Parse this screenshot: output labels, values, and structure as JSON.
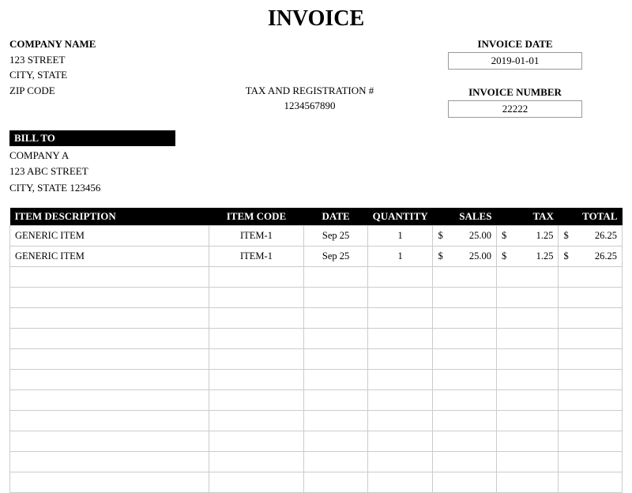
{
  "title": "INVOICE",
  "company": {
    "name": "COMPANY NAME",
    "street": "123 STREET",
    "city_state": "CITY, STATE",
    "zip": "ZIP CODE"
  },
  "tax_reg": {
    "label": "TAX AND REGISTRATION #",
    "value": "1234567890"
  },
  "invoice_date": {
    "label": "INVOICE DATE",
    "value": "2019-01-01"
  },
  "invoice_number": {
    "label": "INVOICE NUMBER",
    "value": "22222"
  },
  "bill_to": {
    "header": "BILL TO",
    "name": "COMPANY A",
    "street": "123 ABC STREET",
    "city_state_zip": "CITY, STATE 123456"
  },
  "items_header": {
    "desc": "ITEM DESCRIPTION",
    "code": "ITEM CODE",
    "date": "DATE",
    "qty": "QUANTITY",
    "sales": "SALES",
    "tax": "TAX",
    "total": "TOTAL"
  },
  "items": [
    {
      "desc": "GENERIC ITEM",
      "code": "ITEM-1",
      "date": "Sep 25",
      "qty": "1",
      "sales": "25.00",
      "tax": "1.25",
      "total": "26.25"
    },
    {
      "desc": "GENERIC ITEM",
      "code": "ITEM-1",
      "date": "Sep 25",
      "qty": "1",
      "sales": "25.00",
      "tax": "1.25",
      "total": "26.25"
    }
  ],
  "currency": "$",
  "empty_rows": 11
}
